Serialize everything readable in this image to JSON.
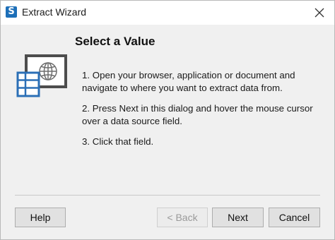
{
  "window": {
    "title": "Extract Wizard",
    "app_icon_glyph": "S"
  },
  "main": {
    "heading": "Select a Value",
    "illustration_icon": "web-page-with-data-table-icon",
    "steps": [
      "1. Open your browser, application or document and navigate to where you want to extract data from.",
      "2. Press Next in this dialog and hover the mouse cursor over a data source field.",
      "3. Click that field."
    ]
  },
  "buttons": {
    "help": "Help",
    "back": "< Back",
    "next": "Next",
    "cancel": "Cancel"
  },
  "colors": {
    "accent_blue": "#2b6fb6",
    "frame_dark": "#4d4d4d",
    "content_bg": "#f0f0f0"
  }
}
